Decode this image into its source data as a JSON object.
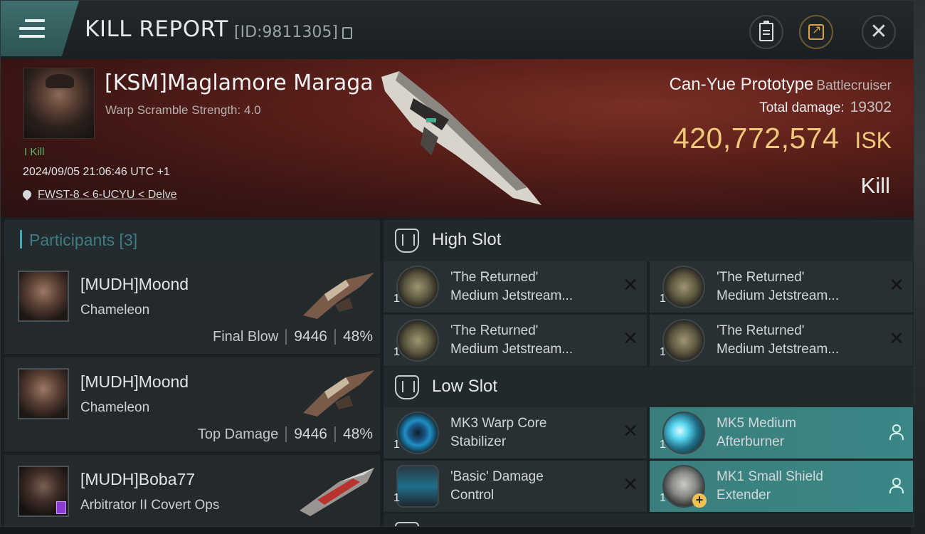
{
  "header": {
    "title": "KILL REPORT",
    "report_id": "[ID:9811305]"
  },
  "victim": {
    "name": "[KSM]Maglamore Maraga",
    "scramble": "Warp Scramble Strength: 4.0",
    "kills_label": "I Kill",
    "datetime": "2024/09/05 21:06:46 UTC +1",
    "location": "FWST-8 < 6-UCYU < Delve",
    "ship_name": "Can-Yue Prototype",
    "ship_class": "Battlecruiser",
    "total_damage_label": "Total damage:",
    "total_damage": "19302",
    "isk_value": "420,772,574",
    "isk_unit": "ISK",
    "result": "Kill"
  },
  "participants": {
    "label": "Participants [3]",
    "items": [
      {
        "name": "[MUDH]Moond",
        "ship": "Chameleon",
        "role": "Final Blow",
        "damage": "9446",
        "percent": "48%"
      },
      {
        "name": "[MUDH]Moond",
        "ship": "Chameleon",
        "role": "Top Damage",
        "damage": "9446",
        "percent": "48%"
      },
      {
        "name": "[MUDH]Boba77",
        "ship": "Arbitrator II Covert Ops",
        "role": "",
        "damage": "",
        "percent": ""
      }
    ]
  },
  "fittings": {
    "high_slot_label": "High Slot",
    "low_slot_label": "Low Slot",
    "high": [
      {
        "qty": "1",
        "name_line1": "'The Returned'",
        "name_line2": "Medium Jetstream..."
      },
      {
        "qty": "1",
        "name_line1": "'The Returned'",
        "name_line2": "Medium Jetstream..."
      },
      {
        "qty": "1",
        "name_line1": "'The Returned'",
        "name_line2": "Medium Jetstream..."
      },
      {
        "qty": "1",
        "name_line1": "'The Returned'",
        "name_line2": "Medium Jetstream..."
      }
    ],
    "low": [
      {
        "qty": "1",
        "name_line1": "MK3 Warp Core",
        "name_line2": "Stabilizer"
      },
      {
        "qty": "1",
        "name_line1": "MK5 Medium",
        "name_line2": "Afterburner"
      },
      {
        "qty": "1",
        "name_line1": "'Basic' Damage",
        "name_line2": "Control"
      },
      {
        "qty": "1",
        "name_line1": "MK1 Small Shield",
        "name_line2": "Extender"
      }
    ]
  },
  "icons": {
    "menu": "menu-icon",
    "copy": "copy-icon",
    "clipboard": "clipboard-icon",
    "share": "share-icon",
    "close": "close-icon",
    "location": "map-pin-icon",
    "slot": "slot-icon",
    "remove": "x-icon",
    "person": "person-icon"
  },
  "colors": {
    "accent": "#3ea8b4",
    "isk": "#f0c879",
    "kill_green": "#5fb46f",
    "rigged_module": "#3a8785"
  }
}
